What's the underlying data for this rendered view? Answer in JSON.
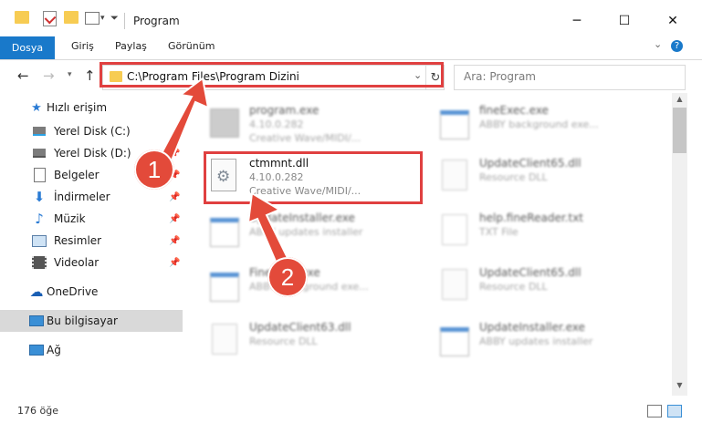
{
  "window": {
    "title": "Program",
    "minimize": "─",
    "maximize": "☐",
    "close": "✕"
  },
  "ribbon": {
    "tabs": [
      "Dosya",
      "Giriş",
      "Paylaş",
      "Görünüm"
    ],
    "expand": "⌄",
    "help": "?"
  },
  "address": {
    "path": "C:\\Program Files\\Program Dizini",
    "search_placeholder": "Ara: Program"
  },
  "sidebar": {
    "quick_access": "Hızlı erişim",
    "items": [
      {
        "label": "Yerel Disk (C:)",
        "pinned": false
      },
      {
        "label": "Yerel Disk (D:)",
        "pinned": true
      },
      {
        "label": "Belgeler",
        "pinned": true
      },
      {
        "label": "İndirmeler",
        "pinned": true
      },
      {
        "label": "Müzik",
        "pinned": true
      },
      {
        "label": "Resimler",
        "pinned": true
      },
      {
        "label": "Videolar",
        "pinned": true
      }
    ],
    "onedrive": "OneDrive",
    "this_pc": "Bu bilgisayar",
    "network": "Ağ"
  },
  "files": [
    {
      "name": "program.exe",
      "line2": "4.10.0.282",
      "line3": "Creative Wave/MIDI/...",
      "icon": "exe-icon",
      "blurred": true
    },
    {
      "name": "fineExec.exe",
      "line2": "ABBY background exe...",
      "line3": "",
      "icon": "exe-icon",
      "blurred": true
    },
    {
      "name": "ctmmnt.dll",
      "line2": "4.10.0.282",
      "line3": "Creative Wave/MIDI/...",
      "icon": "dll-icon",
      "blurred": false
    },
    {
      "name": "UpdateClient65.dll",
      "line2": "Resource DLL",
      "line3": "",
      "icon": "dll-icon",
      "blurred": true
    },
    {
      "name": "UpdateInstaller.exe",
      "line2": "ABBY updates installer",
      "line3": "",
      "icon": "exe-icon",
      "blurred": true
    },
    {
      "name": "help.fineReader.txt",
      "line2": "TXT File",
      "line3": "",
      "icon": "txt-icon",
      "blurred": true
    },
    {
      "name": "FineExec.exe",
      "line2": "ABBY background exe...",
      "line3": "",
      "icon": "exe-icon",
      "blurred": true
    },
    {
      "name": "UpdateClient65.dll",
      "line2": "Resource DLL",
      "line3": "",
      "icon": "dll-icon",
      "blurred": true
    },
    {
      "name": "UpdateClient63.dll",
      "line2": "Resource DLL",
      "line3": "",
      "icon": "dll-icon",
      "blurred": true
    },
    {
      "name": "UpdateInstaller.exe",
      "line2": "ABBY updates installer",
      "line3": "",
      "icon": "exe-icon",
      "blurred": true
    }
  ],
  "status": {
    "count": "176 öğe"
  },
  "annotations": {
    "step1": "1",
    "step2": "2",
    "highlight_color": "#e04040"
  }
}
